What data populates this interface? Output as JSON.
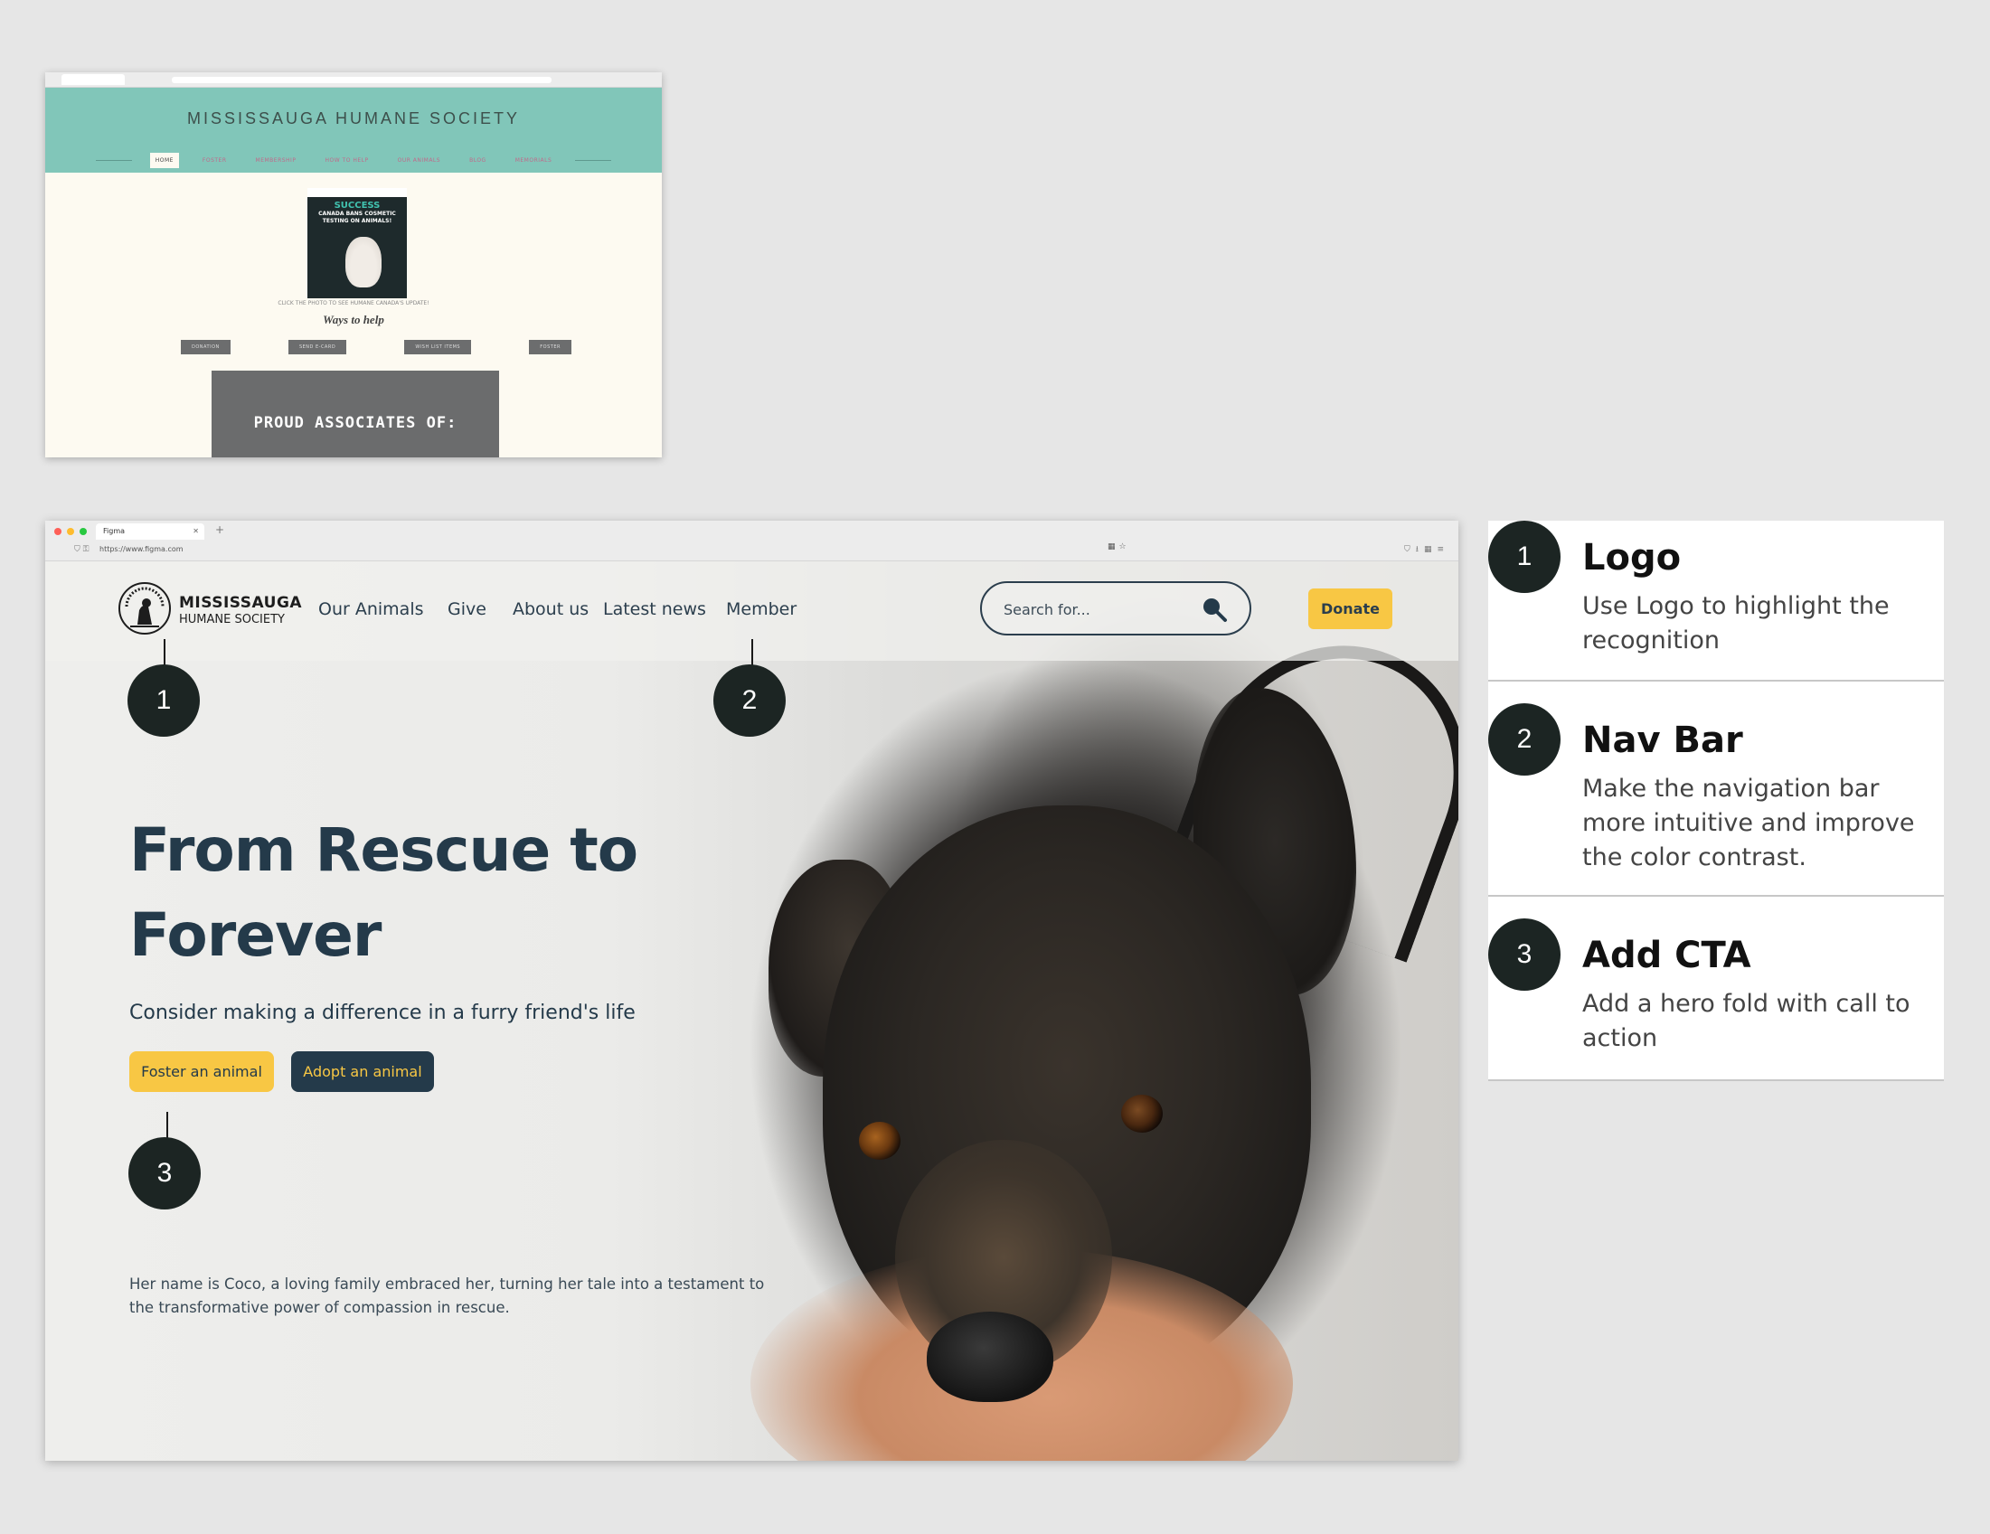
{
  "old_site": {
    "title": "MISSISSAUGA HUMANE SOCIETY",
    "nav": [
      "HOME",
      "FOSTER",
      "MEMBERSHIP",
      "HOW TO HELP",
      "OUR ANIMALS",
      "BLOG",
      "MEMORIALS"
    ],
    "promo": {
      "headline": "SUCCESS",
      "text": "CANADA BANS COSMETIC TESTING ON ANIMALS!"
    },
    "caption": "CLICK THE PHOTO TO SEE HUMANE CANADA'S UPDATE!",
    "ways_title": "Ways to help",
    "buttons": [
      "DONATION",
      "SEND E-CARD",
      "WISH LIST ITEMS",
      "FOSTER"
    ],
    "associates": "PROUD ASSOCIATES OF:"
  },
  "browser": {
    "tab_title": "Figma",
    "url": "https://www.figma.com"
  },
  "mockup": {
    "logo_line1": "MISSISSAUGA",
    "logo_line2": "HUMANE SOCIETY",
    "nav": [
      "Our Animals",
      "Give",
      "About us",
      "Latest news",
      "Member"
    ],
    "search_placeholder": "Search for...",
    "donate_label": "Donate",
    "headline": "From Rescue to Forever",
    "subheadline": "Consider making a difference in a furry friend's life",
    "cta_foster": "Foster an animal",
    "cta_adopt": "Adopt an animal",
    "story": "Her name is Coco, a loving family embraced her, turning her tale into a testament to the transformative power of compassion in rescue."
  },
  "pins": [
    "1",
    "2",
    "3"
  ],
  "annotations": [
    {
      "number": "1",
      "title": "Logo",
      "description": "Use Logo to highlight the recognition"
    },
    {
      "number": "2",
      "title": "Nav Bar",
      "description": "Make the navigation bar more intuitive and improve the color contrast."
    },
    {
      "number": "3",
      "title": "Add CTA",
      "description": "Add a hero fold with call to action"
    }
  ],
  "colors": {
    "teal_header": "#81c6b9",
    "accent_yellow": "#f8c744",
    "navy": "#243a4a",
    "pin_dark": "#1c2523"
  }
}
